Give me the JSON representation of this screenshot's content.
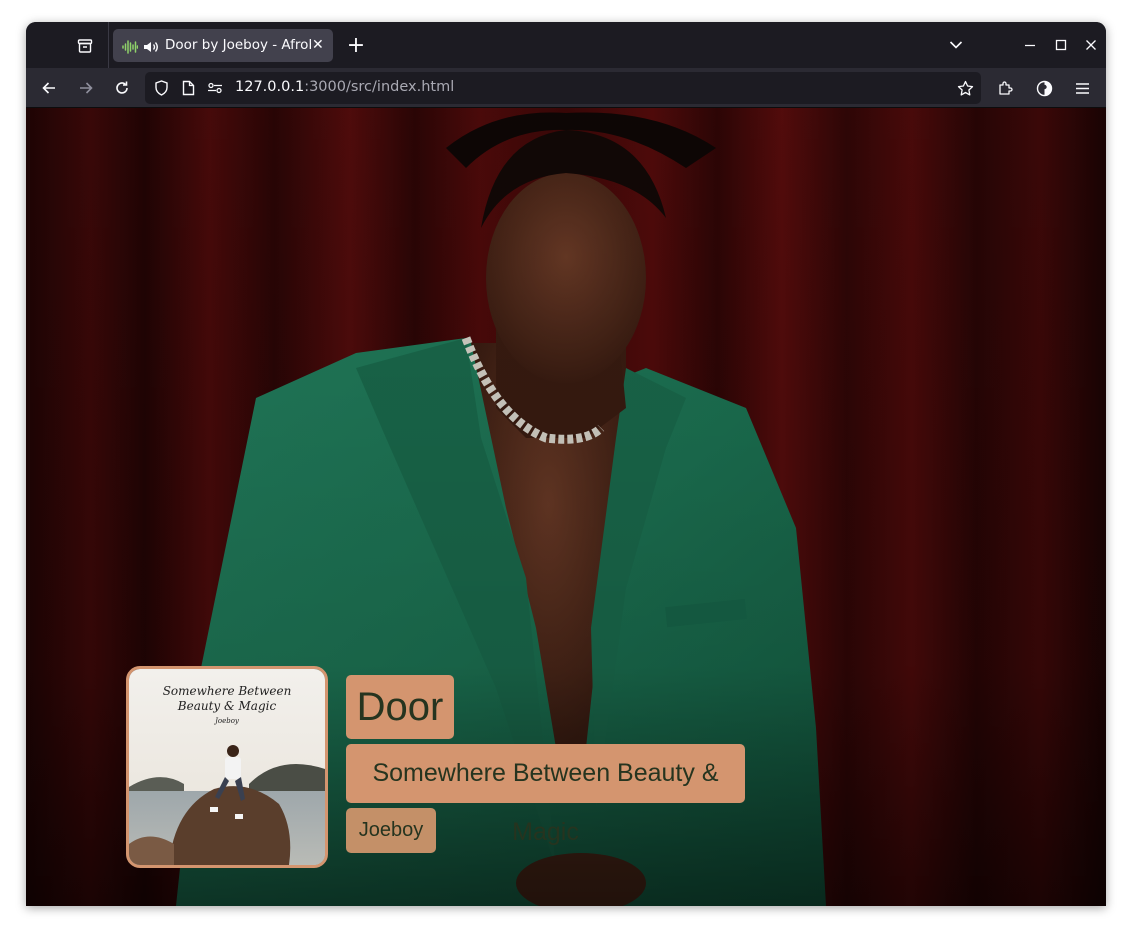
{
  "browser": {
    "tab": {
      "title": "Door by Joeboy - Afrobeats Player",
      "close_label": "✕",
      "playing_audio": true
    },
    "new_tab_label": "+",
    "url": {
      "host": "127.0.0.1",
      "rest": ":3000/src/index.html"
    }
  },
  "player": {
    "song_title": "Door",
    "album_title": "Somewhere Between Beauty & Magic",
    "artist_name": "Joeboy",
    "album_cover": {
      "script_line1": "Somewhere Between",
      "script_line2": "Beauty & Magic",
      "signature": "Joeboy"
    }
  },
  "colors": {
    "accent": "#d4956f",
    "label_text": "#26341f",
    "suit_green": "#1f7a5a",
    "curtain_red": "#5a0c0c"
  }
}
